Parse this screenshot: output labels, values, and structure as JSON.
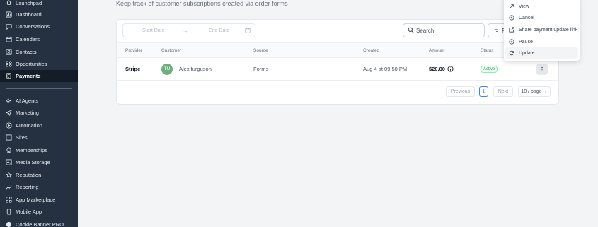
{
  "sidebar": {
    "items": [
      {
        "label": "Launchpad",
        "icon": "rocket-icon"
      },
      {
        "label": "Dashboard",
        "icon": "dashboard-icon"
      },
      {
        "label": "Conversations",
        "icon": "chat-icon"
      },
      {
        "label": "Calendars",
        "icon": "calendar-icon"
      },
      {
        "label": "Contacts",
        "icon": "contacts-icon"
      },
      {
        "label": "Opportunities",
        "icon": "opportunities-icon"
      },
      {
        "label": "Payments",
        "icon": "payments-icon",
        "active": true
      },
      {
        "label": "AI Agents",
        "icon": "ai-sparkle-icon"
      },
      {
        "label": "Marketing",
        "icon": "send-icon"
      },
      {
        "label": "Automation",
        "icon": "automation-icon"
      },
      {
        "label": "Sites",
        "icon": "sites-icon"
      },
      {
        "label": "Memberships",
        "icon": "memberships-icon"
      },
      {
        "label": "Media Storage",
        "icon": "media-icon"
      },
      {
        "label": "Reputation",
        "icon": "star-icon"
      },
      {
        "label": "Reporting",
        "icon": "reporting-icon"
      },
      {
        "label": "App Marketplace",
        "icon": "apps-icon"
      },
      {
        "label": "Mobile App",
        "icon": "mobile-icon"
      },
      {
        "label": "Cookie Banner PRO",
        "icon": "cookie-icon"
      }
    ]
  },
  "main": {
    "subtitle": "Keep track of customer subscriptions created via order forms",
    "date_range": {
      "start_placeholder": "Start Date",
      "end_placeholder": "End Date"
    },
    "search_placeholder": "Search",
    "filter_label": "Fi",
    "table": {
      "headers": [
        "Provider",
        "Customer",
        "Source",
        "Created",
        "Amount",
        "Status"
      ],
      "rows": [
        {
          "provider": "Stripe",
          "customer_initials": "TU",
          "customer_name": "Alex furguson",
          "source": "Forms",
          "created": "Aug 4 at 09:50 PM",
          "amount": "$20.00",
          "status": "Active"
        }
      ]
    },
    "pagination": {
      "previous": "Previous",
      "current_page": "1",
      "next": "Next",
      "page_size": "10 / page"
    }
  },
  "row_menu": {
    "items": [
      {
        "label": "View",
        "icon": "arrow-up-right-icon"
      },
      {
        "label": "Cancel",
        "icon": "cancel-circle-icon"
      },
      {
        "label": "Share payment update link",
        "icon": "external-link-icon"
      },
      {
        "label": "Pause",
        "icon": "pause-circle-icon"
      },
      {
        "label": "Update",
        "icon": "refresh-icon"
      }
    ]
  },
  "colors": {
    "sidebar_bg": "#253141",
    "sidebar_active_bg": "#141c27",
    "status_active": "#16a34a",
    "avatar_bg": "#6fae7e"
  }
}
